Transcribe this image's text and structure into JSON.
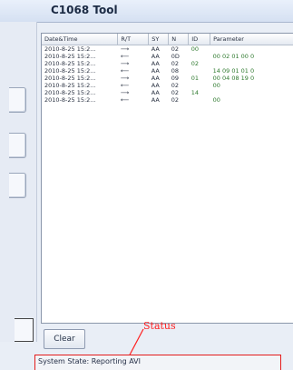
{
  "window": {
    "title": "C1068 Tool"
  },
  "grid": {
    "columns": [
      "Date&Time",
      "R/T",
      "SY",
      "N",
      "ID",
      "Parameter"
    ],
    "rows": [
      [
        "2010-8-25  15:2...",
        "⟶",
        "AA",
        "02",
        "00",
        ""
      ],
      [
        "2010-8-25  15:2...",
        "⟵",
        "AA",
        "0D",
        "",
        "00 02 01 00 0"
      ],
      [
        "2010-8-25  15:2...",
        "⟶",
        "AA",
        "02",
        "02",
        ""
      ],
      [
        "2010-8-25  15:2...",
        "⟵",
        "AA",
        "08",
        "",
        "14 09 01 01 0"
      ],
      [
        "2010-8-25  15:2...",
        "⟶",
        "AA",
        "09",
        "01",
        "00 04 08 19 0"
      ],
      [
        "2010-8-25  15:2...",
        "⟵",
        "AA",
        "02",
        "",
        "00"
      ],
      [
        "2010-8-25  15:2...",
        "⟶",
        "AA",
        "02",
        "14",
        ""
      ],
      [
        "2010-8-25  15:2...",
        "⟵",
        "AA",
        "02",
        "",
        "00"
      ]
    ]
  },
  "buttons": {
    "clear_label": "Clear"
  },
  "annotation": {
    "label": "Status"
  },
  "status": {
    "text": "System State: Reporting AVI"
  }
}
